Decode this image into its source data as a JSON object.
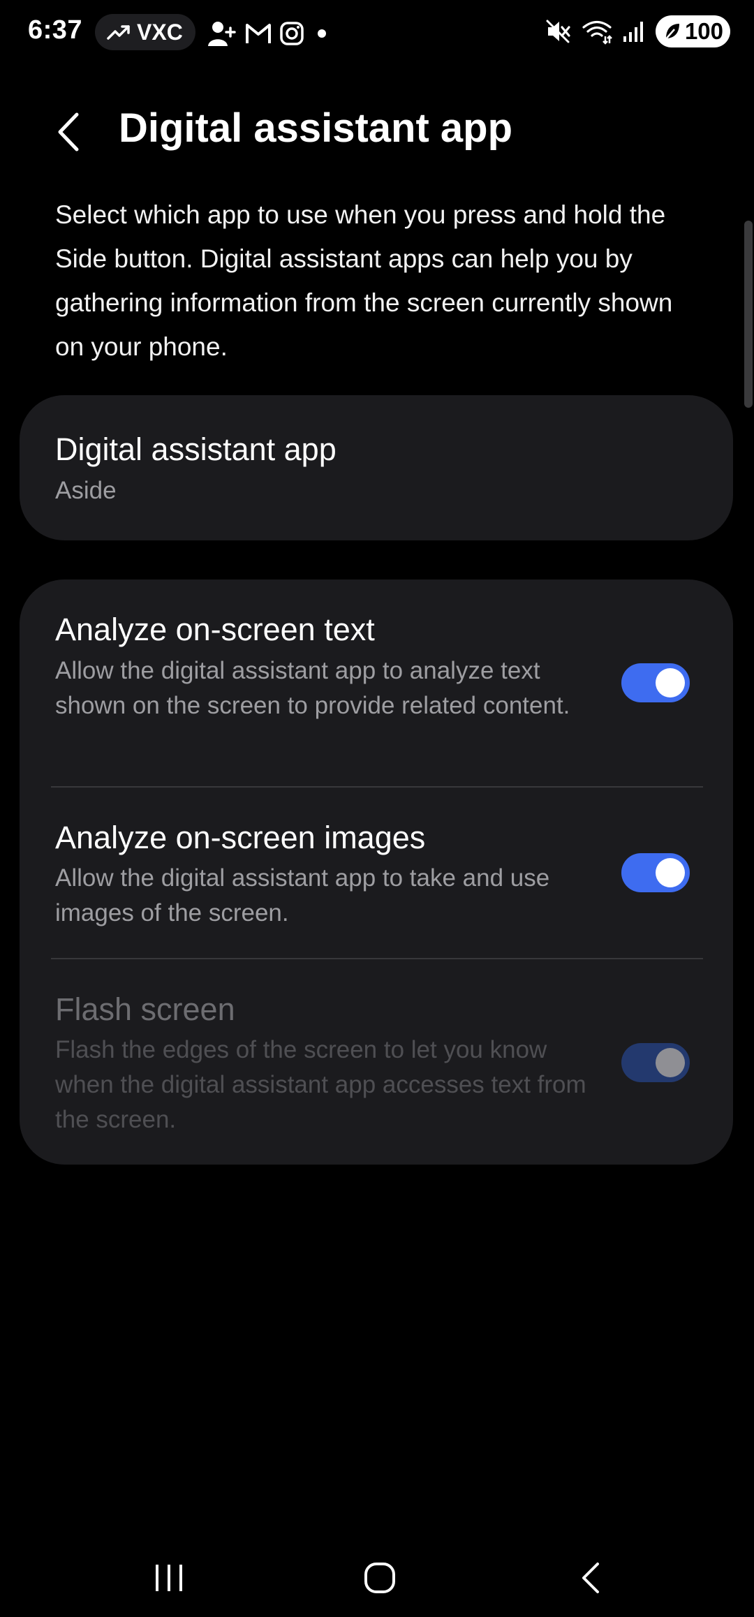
{
  "status_bar": {
    "time": "6:37",
    "ticker": "VXC",
    "battery": "100"
  },
  "header": {
    "title": "Digital assistant app"
  },
  "description": "Select which app to use when you press and hold the Side button. Digital assistant apps can help you by gathering information from the screen currently shown on your phone.",
  "assistant_app": {
    "label": "Digital assistant app",
    "value": "Aside"
  },
  "settings": [
    {
      "title": "Analyze on-screen text",
      "description": "Allow the digital assistant app to analyze text shown on the screen to provide related content.",
      "enabled": true,
      "on": true
    },
    {
      "title": "Analyze on-screen images",
      "description": "Allow the digital assistant app to take and use images of the screen.",
      "enabled": true,
      "on": true
    },
    {
      "title": "Flash screen",
      "description": "Flash the edges of the screen to let you know when the digital assistant app accesses text from the screen.",
      "enabled": false,
      "on": true
    }
  ],
  "colors": {
    "accent": "#3e6cf0",
    "card": "#1b1b1e",
    "background": "#000000"
  },
  "icons": [
    "trending-up-icon",
    "add-contact-icon",
    "gmail-icon",
    "instagram-icon",
    "dot-icon",
    "mute-icon",
    "wifi-icon",
    "signal-icon",
    "battery-saver-icon",
    "back-arrow-icon",
    "recents-icon",
    "home-icon",
    "nav-back-icon"
  ]
}
